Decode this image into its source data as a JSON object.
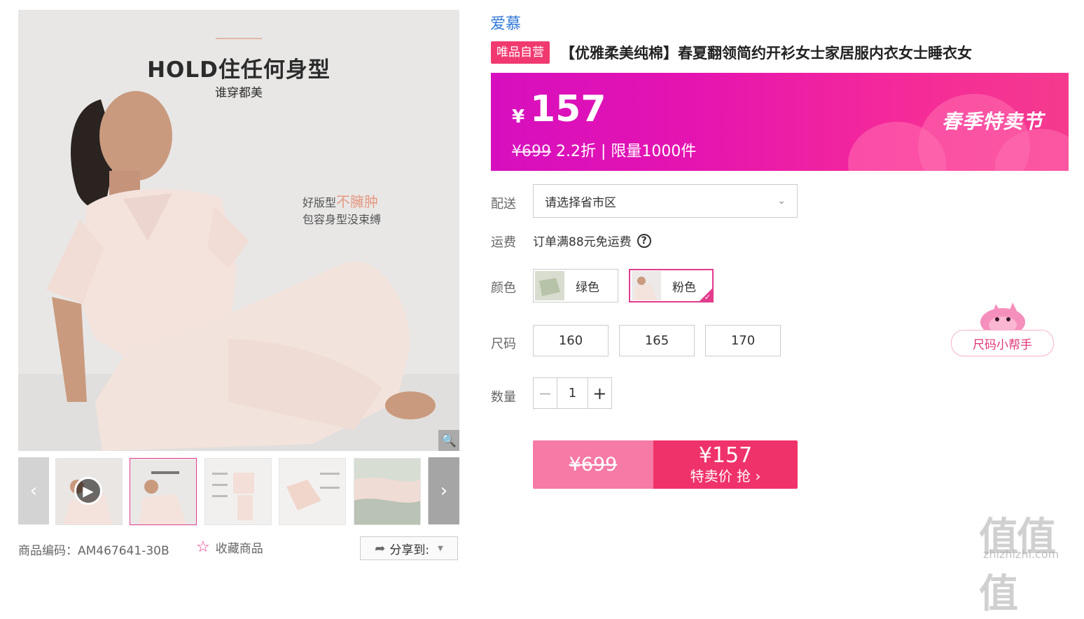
{
  "gallery": {
    "main_heading": "HOLD住任何身型",
    "main_subheading": "谁穿都美",
    "feature_line1_prefix": "好版型",
    "feature_line1_accent": "不臃肿",
    "feature_line2": "包容身型没束缚",
    "zoom_icon": "search-icon",
    "thumbnails": [
      {
        "name": "thumb-video",
        "has_play": true
      },
      {
        "name": "thumb-2",
        "active": true
      },
      {
        "name": "thumb-3"
      },
      {
        "name": "thumb-4"
      },
      {
        "name": "thumb-5"
      }
    ]
  },
  "meta": {
    "product_code": "商品编码：AM467641-30B",
    "favorite_label": "收藏商品",
    "share_label": "分享到:"
  },
  "product": {
    "brand": "爱慕",
    "badge": "唯品自营",
    "title": "【优雅柔美纯棉】春夏翻领简约开衫女士家居服内衣女士睡衣女"
  },
  "banner": {
    "currency": "¥",
    "price": "157",
    "original_price": "¥699",
    "discount": " 2.2折 | 限量1000件",
    "promo_tag": "春季特卖节",
    "colors": {
      "start": "#d60fbf",
      "end": "#f53a8e"
    }
  },
  "delivery": {
    "label": "配送",
    "placeholder": "请选择省市区"
  },
  "shipping": {
    "label": "运费",
    "text": "订单满88元免运费"
  },
  "color": {
    "label": "颜色",
    "options": [
      {
        "label": "绿色",
        "selected": false
      },
      {
        "label": "粉色",
        "selected": true
      }
    ]
  },
  "size": {
    "label": "尺码",
    "options": [
      "160",
      "165",
      "170"
    ],
    "helper_label": "尺码小帮手"
  },
  "quantity": {
    "label": "数量",
    "value": "1"
  },
  "buy": {
    "original_price": "¥699",
    "price": "¥157",
    "action_label": "特卖价 抢"
  },
  "watermark": {
    "logo": "值值值",
    "site": "zhizhizhi.com"
  }
}
